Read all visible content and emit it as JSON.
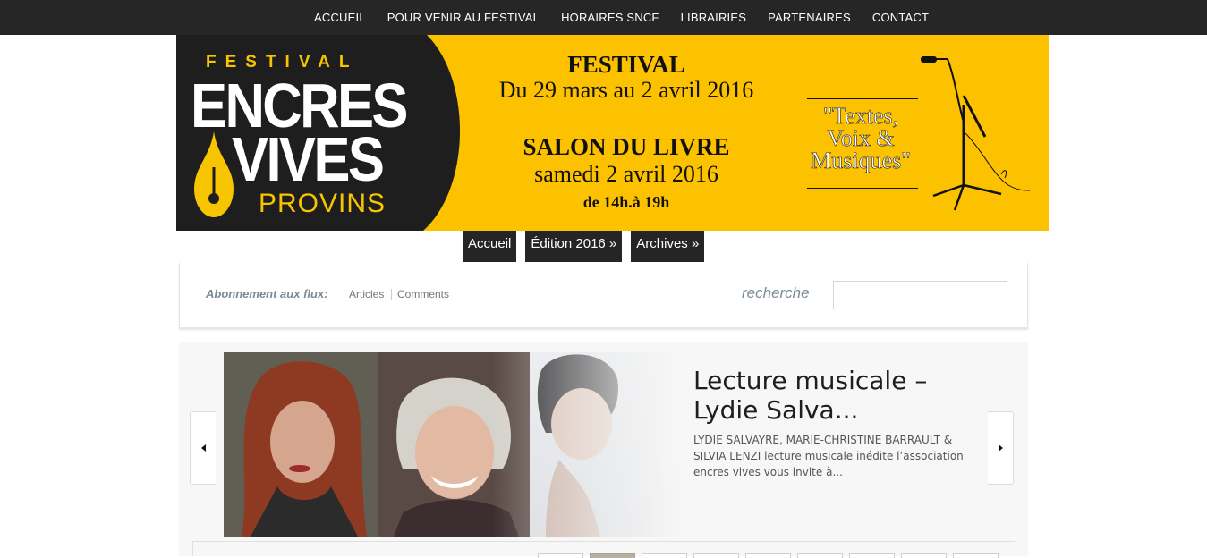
{
  "top_nav": {
    "items": [
      {
        "label": "ACCUEIL"
      },
      {
        "label": "POUR VENIR AU FESTIVAL"
      },
      {
        "label": "HORAIRES SNCF"
      },
      {
        "label": "LIBRAIRIES"
      },
      {
        "label": "PARTENAIRES"
      },
      {
        "label": "CONTACT"
      }
    ]
  },
  "banner": {
    "logo": {
      "festival": "FESTIVAL",
      "encres": "ENCRES",
      "vives": "VIVES",
      "provins": "PROVINS"
    },
    "festival_title": "FESTIVAL",
    "festival_dates": "Du 29 mars au 2 avril 2016",
    "salon_title": "SALON DU LIVRE",
    "salon_date": "samedi 2 avril 2016",
    "salon_hours": "de 14h.à 19h",
    "tagline": "\"Textes, Voix & Musiques\"",
    "colors": {
      "background": "#fcc200",
      "logo_dark": "#1e1e1e",
      "logo_yellow": "#f6c400"
    }
  },
  "sub_nav": {
    "items": [
      {
        "label": "Accueil"
      },
      {
        "label": "Édition 2016 »"
      },
      {
        "label": "Archives »"
      }
    ]
  },
  "feeds": {
    "label": "Abonnement aux flux:",
    "links": [
      {
        "label": "Articles"
      },
      {
        "label": "Comments"
      }
    ]
  },
  "search": {
    "label": "recherche",
    "value": "",
    "placeholder": ""
  },
  "featured": {
    "title": "Lecture musicale – Lydie Salva...",
    "excerpt": "LYDIE SALVAYRE, MARIE-CHRISTINE BARRAULT & SILVIA LENZI   lecture musicale inédite l’association encres vives vous invite à...",
    "prev_icon": "chevron-left-icon",
    "next_icon": "chevron-right-icon",
    "thumbnail_count": 9,
    "active_thumbnail": 2
  }
}
